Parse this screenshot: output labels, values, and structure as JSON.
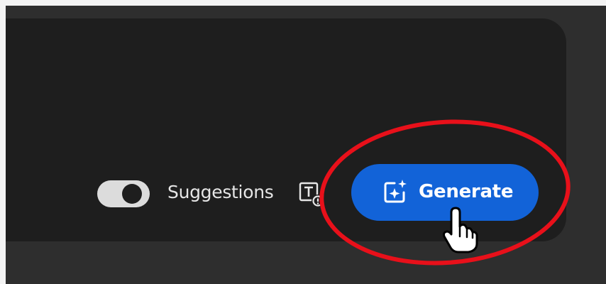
{
  "toolbar": {
    "suggestions_toggle": {
      "label": "Suggestions",
      "state": "on",
      "track_color": "#dcdcdc",
      "knob_color": "#1e1e1e"
    },
    "text_info_icon": "text-sparkle-icon",
    "generate_button": {
      "label": "Generate",
      "icon": "image-sparkle-icon",
      "color": "#1263d8"
    }
  },
  "annotation": {
    "ring_color": "#e8101a"
  },
  "cursor": "hand-pointer-icon",
  "colors": {
    "panel": "#1e1e1e",
    "backdrop": "#2e2e2e",
    "page": "#f4f4f4"
  }
}
